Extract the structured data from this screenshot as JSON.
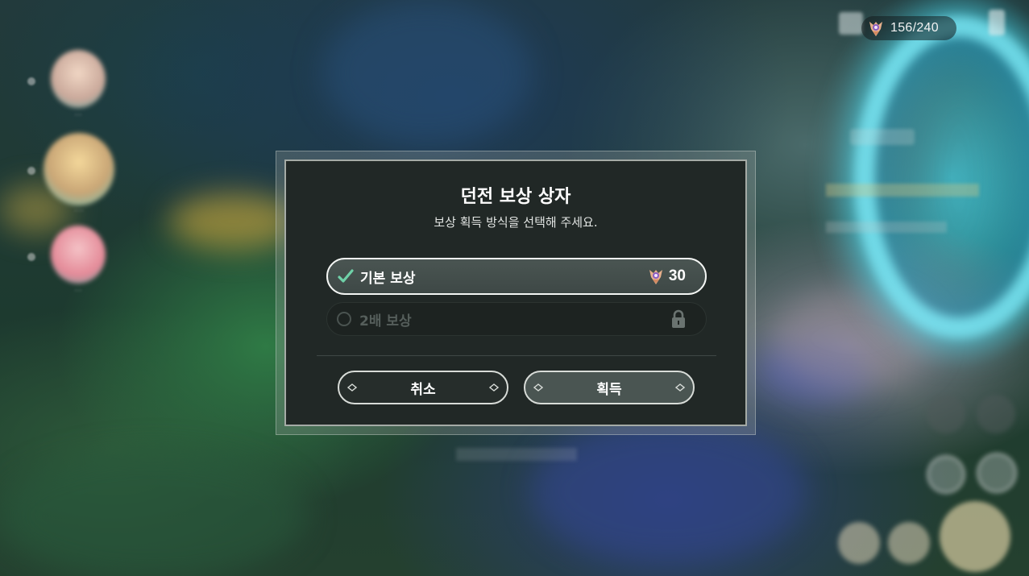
{
  "hud": {
    "resin_current": "156/240",
    "resin_icon": "resin-icon"
  },
  "modal": {
    "title": "던전 보상 상자",
    "subtitle": "보상 획득 방식을 선택해 주세요.",
    "options": [
      {
        "label": "기본 보상",
        "cost": "30",
        "selected": true,
        "locked": false,
        "icon": "check-icon"
      },
      {
        "label": "2배 보상",
        "selected": false,
        "locked": true,
        "icon": "lock-icon"
      }
    ],
    "buttons": {
      "cancel": "취소",
      "confirm": "획득"
    }
  },
  "colors": {
    "modal_bg": "#212826",
    "selected_option_bg": "#4a5552",
    "check_green": "#6fd1a8",
    "text_white": "#ffffff",
    "disabled_text": "#555e5b"
  }
}
